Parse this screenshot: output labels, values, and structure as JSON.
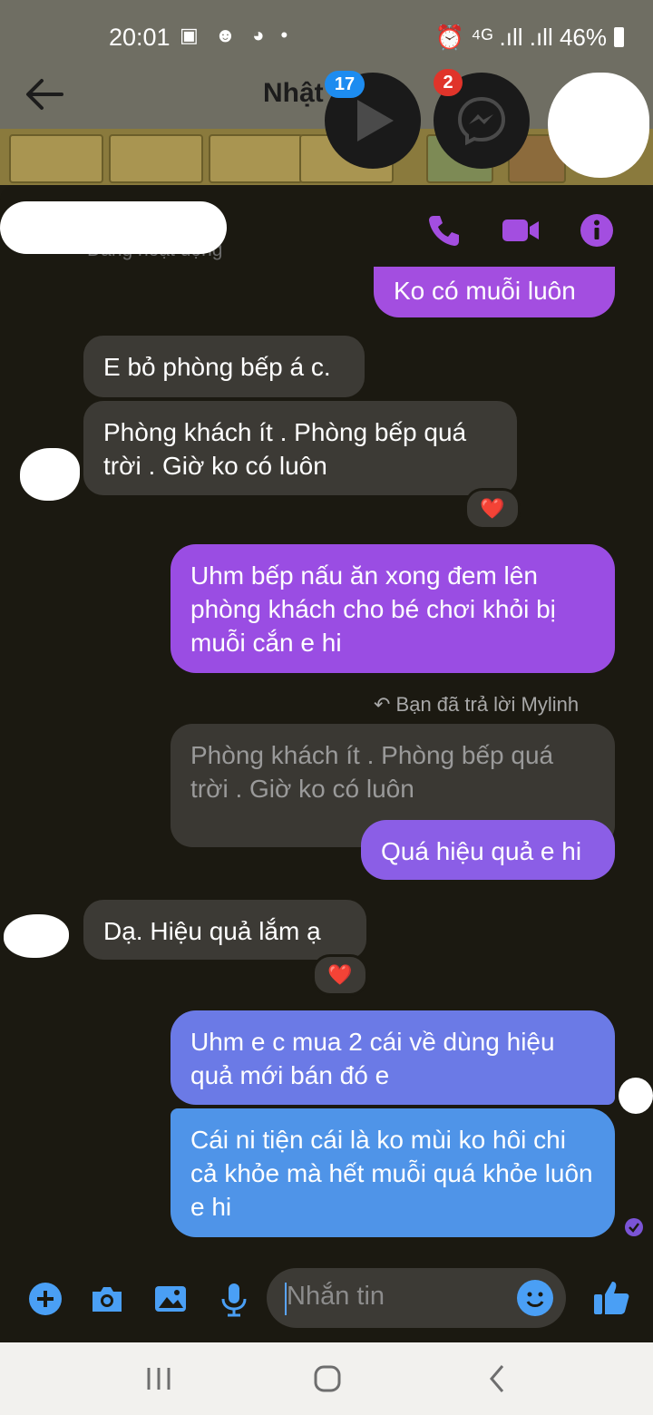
{
  "status_bar": {
    "time": "20:01",
    "notification_icons": "▣ ☻ ◕ •",
    "right_text": "⏰ ⁴ᴳ .ıll .ıll 46%",
    "battery_percent": 46
  },
  "header": {
    "contact_name": "Nhật",
    "video_badge": "17",
    "messenger_badge": "2"
  },
  "chat_header": {
    "active_status": "Đang hoạt động"
  },
  "messages": [
    {
      "text": "Ko có muỗi luôn"
    },
    {
      "text": "E bỏ phòng bếp á c."
    },
    {
      "text": "Phòng khách ít . Phòng bếp quá trời . Giờ ko có luôn",
      "reaction": "❤️"
    },
    {
      "text": "Uhm bếp nấu ăn xong  đem lên phòng khách cho bé chơi khỏi bị muỗi cắn e hi"
    },
    {
      "reply_label": "Bạn đã trả lời Mylinh",
      "quoted": "Phòng khách ít . Phòng bếp quá trời . Giờ ko có luôn",
      "text": "Quá hiệu quả e hi"
    },
    {
      "text": "Dạ.  Hiệu quả lắm ạ",
      "reaction": "❤️"
    },
    {
      "text": "Uhm e c mua 2 cái về dùng hiệu quả mới bán đó e"
    },
    {
      "text": "Cái ni tiện cái là ko mùi ko hôi chi cả khỏe mà hết muỗi quá khỏe luôn e hi"
    }
  ],
  "composer": {
    "placeholder": "Nhắn tin"
  },
  "icons": [
    "back-arrow-icon",
    "play-icon",
    "messenger-icon",
    "phone-icon",
    "video-camera-icon",
    "info-icon",
    "plus-icon",
    "camera-icon",
    "image-icon",
    "microphone-icon",
    "emoji-icon",
    "thumbs-up-icon",
    "recent-apps-icon",
    "home-icon",
    "nav-back-icon"
  ],
  "colors": {
    "accent_purple": "#a34ee0",
    "bubble_gradient_top": "#9a4de3",
    "bubble_gradient_bottom": "#4f94e8",
    "incoming_bubble": "#3c3a35",
    "composer_blue": "#4a9ff5"
  }
}
